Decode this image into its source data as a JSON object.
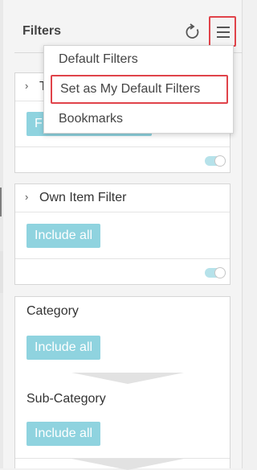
{
  "header": {
    "title": "Filters",
    "reset_icon": "reset-icon",
    "menu_icon": "hamburger-menu-icon"
  },
  "menu": {
    "items": [
      {
        "label": "Default Filters"
      },
      {
        "label": "Set as My Default Filters",
        "highlighted": true
      },
      {
        "label": "Bookmarks"
      }
    ]
  },
  "filters": {
    "first": {
      "title_fragment": "T",
      "chip_fragment": "F",
      "toggle_on": true
    },
    "own_item": {
      "title": "Own Item Filter",
      "chip_label": "Include all",
      "toggle_on": true
    },
    "category": {
      "title": "Category",
      "chip_label": "Include all"
    },
    "sub_category": {
      "title": "Sub-Category",
      "chip_label": "Include all"
    }
  },
  "colors": {
    "accent": "#8fd3df",
    "highlight": "#e0434a",
    "toggle": "#b6e2ea"
  }
}
